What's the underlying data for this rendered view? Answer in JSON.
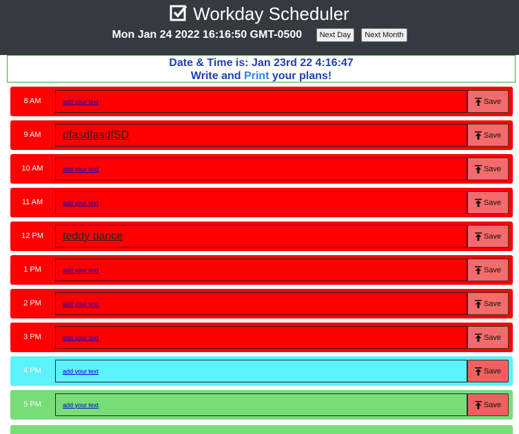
{
  "header": {
    "title": "Workday Scheduler",
    "current_datetime": "Mon Jan 24 2022 16:16:50 GMT-0500",
    "next_day_label": "Next Day",
    "next_month_label": "Next Month"
  },
  "banner": {
    "line1": "Date & Time is: Jan 23rd 22 4:16:47",
    "line2_write": "Write and ",
    "line2_print": "Print",
    "line2_rest": " your plans!"
  },
  "colors": {
    "past": "#ff0000",
    "present": "#5cf2fa",
    "future": "#77dd77",
    "header_bg": "#343a40"
  },
  "save_label": "Save",
  "rows": [
    {
      "hour": "8 AM",
      "text": "add your text",
      "state": "past"
    },
    {
      "hour": "9 AM",
      "text": "dfasdfasdfSD",
      "state": "past"
    },
    {
      "hour": "10 AM",
      "text": "add your text",
      "state": "past"
    },
    {
      "hour": "11 AM",
      "text": "add your text",
      "state": "past"
    },
    {
      "hour": "12 PM",
      "text": "teddy dance",
      "state": "past"
    },
    {
      "hour": "1 PM",
      "text": "add your text",
      "state": "past"
    },
    {
      "hour": "2 PM",
      "text": "add your text",
      "state": "past"
    },
    {
      "hour": "3 PM",
      "text": "add your text",
      "state": "past"
    },
    {
      "hour": "4 PM",
      "text": "add your text",
      "state": "present"
    },
    {
      "hour": "5 PM",
      "text": "add your text",
      "state": "future"
    }
  ]
}
